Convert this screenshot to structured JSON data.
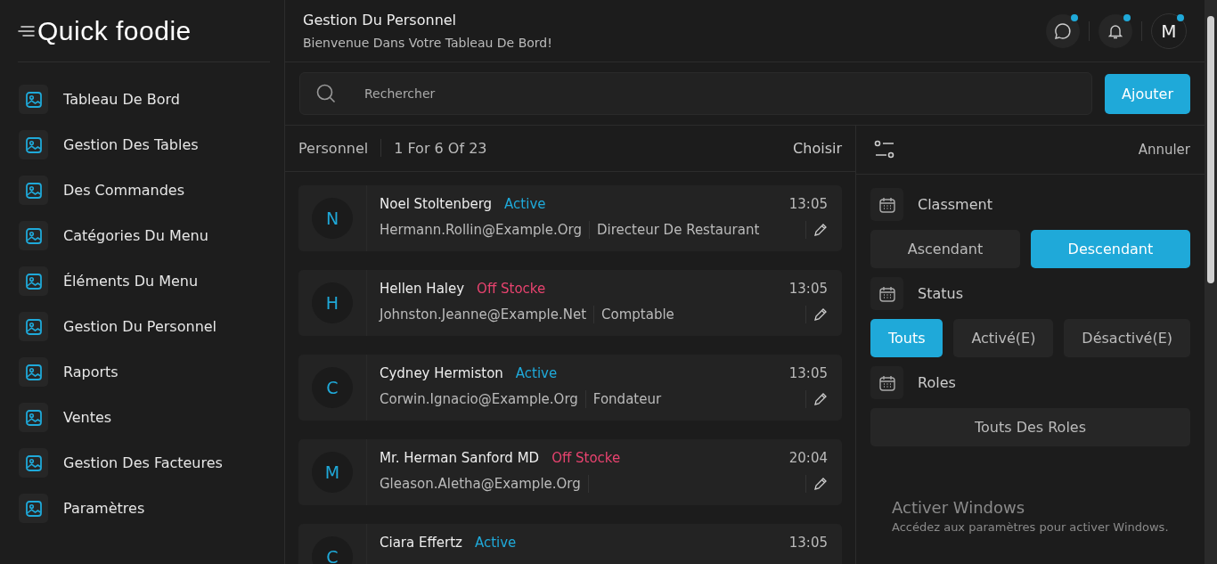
{
  "logo": {
    "text": "Quick foodie"
  },
  "sidebar": {
    "items": [
      {
        "label": "Tableau De Bord"
      },
      {
        "label": "Gestion Des Tables"
      },
      {
        "label": "Des Commandes"
      },
      {
        "label": "Catégories Du Menu"
      },
      {
        "label": "Éléments Du Menu"
      },
      {
        "label": "Gestion Du Personnel"
      },
      {
        "label": "Raports"
      },
      {
        "label": "Ventes"
      },
      {
        "label": "Gestion Des Facteures"
      },
      {
        "label": "Paramètres"
      }
    ]
  },
  "header": {
    "title": "Gestion Du Personnel",
    "subtitle": "Bienvenue Dans Votre Tableau De Bord!",
    "avatar": "M"
  },
  "search": {
    "placeholder": "Rechercher",
    "button": "Ajouter"
  },
  "list": {
    "title": "Personnel",
    "range": "1 For 6 Of 23",
    "action": "Choisir",
    "staff": [
      {
        "initial": "N",
        "name": "Noel Stoltenberg",
        "status": "Active",
        "color": "#1fa9d9",
        "time": "13:05",
        "email": "Hermann.Rollin@Example.Org",
        "role": "Directeur De Restaurant"
      },
      {
        "initial": "H",
        "name": "Hellen Haley",
        "status": "Off Stocke",
        "color": "#e8436f",
        "time": "13:05",
        "email": "Johnston.Jeanne@Example.Net",
        "role": "Comptable"
      },
      {
        "initial": "C",
        "name": "Cydney Hermiston",
        "status": "Active",
        "color": "#1fa9d9",
        "time": "13:05",
        "email": "Corwin.Ignacio@Example.Org",
        "role": "Fondateur"
      },
      {
        "initial": "M",
        "name": "Mr. Herman Sanford MD",
        "status": "Off Stocke",
        "color": "#e8436f",
        "time": "20:04",
        "email": "Gleason.Aletha@Example.Org"
      },
      {
        "initial": "C",
        "name": "Ciara Effertz",
        "status": "Active",
        "color": "#1fa9d9",
        "time": "13:05"
      }
    ]
  },
  "filters": {
    "cancel": "Annuler",
    "groups": [
      {
        "label": "Classment",
        "options": [
          {
            "label": "Ascendant",
            "selected": false
          },
          {
            "label": "Descendant",
            "selected": true
          }
        ]
      },
      {
        "label": "Status",
        "options": [
          {
            "label": "Touts",
            "selected": true
          },
          {
            "label": "Activé(E)",
            "selected": false
          },
          {
            "label": "Désactivé(E)",
            "selected": false
          }
        ]
      },
      {
        "label": "Roles",
        "options": [
          {
            "label": "Touts Des Roles",
            "selected": false
          }
        ]
      }
    ]
  },
  "os_overlay": {
    "title": "Activer Windows",
    "message": "Accédez aux paramètres pour activer Windows."
  }
}
